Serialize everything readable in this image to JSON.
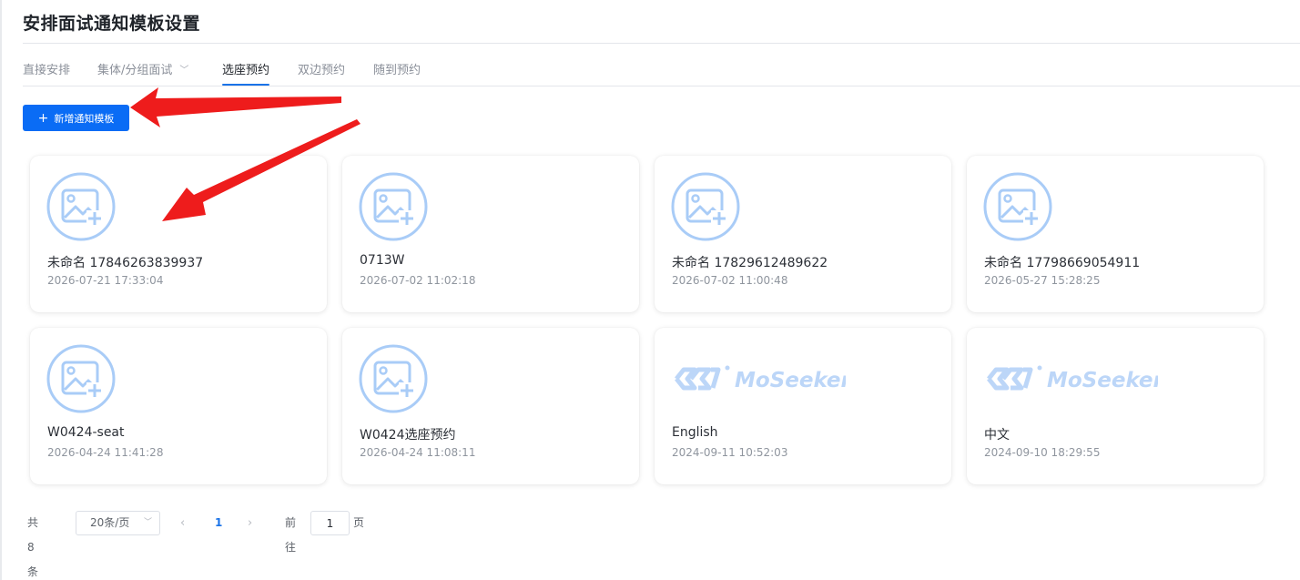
{
  "page": {
    "title": "安排面试通知模板设置"
  },
  "tabs": [
    {
      "label": "直接安排"
    },
    {
      "label": "集体/分组面试"
    },
    {
      "label": "选座预约"
    },
    {
      "label": "双边预约"
    },
    {
      "label": "随到预约"
    }
  ],
  "active_tab": "选座预约",
  "toolbar": {
    "add_label": "新增通知模板"
  },
  "cards": [
    {
      "name": "未命名 17846263839937",
      "time": "2026-07-21 17:33:04",
      "thumb": "image-placeholder-icon"
    },
    {
      "name": "0713W",
      "time": "2026-07-02 11:02:18",
      "thumb": "image-placeholder-icon"
    },
    {
      "name": "未命名 17829612489622",
      "time": "2026-07-02 11:00:48",
      "thumb": "image-placeholder-icon"
    },
    {
      "name": "未命名 17798669054911",
      "time": "2026-05-27 15:28:25",
      "thumb": "image-placeholder-icon"
    },
    {
      "name": "W0424-seat",
      "time": "2026-04-24 11:41:28",
      "thumb": "image-placeholder-icon"
    },
    {
      "name": "W0424选座预约",
      "time": "2026-04-24 11:08:11",
      "thumb": "image-placeholder-icon"
    },
    {
      "name": "English",
      "time": "2024-09-11 10:52:03",
      "thumb": "moseeker-logo",
      "logo_text": "MoSeeker"
    },
    {
      "name": "中文",
      "time": "2024-09-10 18:29:55",
      "thumb": "moseeker-logo",
      "logo_text": "MoSeeker"
    }
  ],
  "pagination": {
    "total_text": "共 8 条",
    "page_size": "20条/页",
    "current_page": "1",
    "goto_label": "前往",
    "goto_value": "1",
    "page_unit": "页"
  },
  "colors": {
    "primary": "#0a6cf5",
    "tab_active_underline": "#1a73e8",
    "placeholder_icon": "#a9ccf7",
    "annotation_arrow": "#ee1c1c"
  }
}
